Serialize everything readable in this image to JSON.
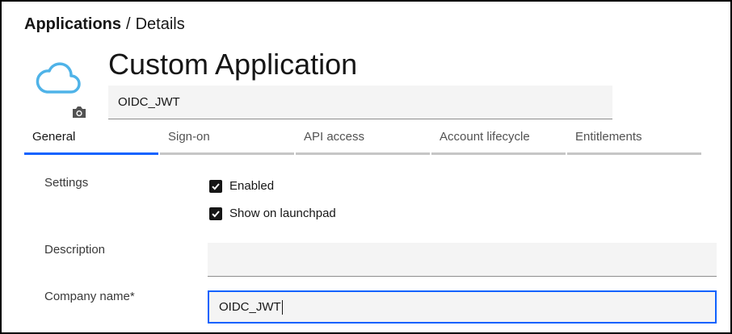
{
  "breadcrumb": {
    "parent": "Applications",
    "separator": "/",
    "current": "Details"
  },
  "app": {
    "title": "Custom Application",
    "name_value": "OIDC_JWT",
    "icon": "cloud-icon",
    "photo_icon": "camera-icon"
  },
  "tabs": [
    {
      "label": "General",
      "active": true
    },
    {
      "label": "Sign-on",
      "active": false
    },
    {
      "label": "API access",
      "active": false
    },
    {
      "label": "Account lifecycle",
      "active": false
    },
    {
      "label": "Entitlements",
      "active": false
    }
  ],
  "form": {
    "settings_label": "Settings",
    "enabled_label": "Enabled",
    "enabled_checked": true,
    "launchpad_label": "Show on launchpad",
    "launchpad_checked": true,
    "description_label": "Description",
    "description_value": "",
    "company_label": "Company name*",
    "company_value": "OIDC_JWT"
  },
  "colors": {
    "accent": "#0f62fe",
    "cloud": "#4fb3e8",
    "field_bg": "#f4f4f4",
    "tab_inactive_border": "#c6c6c6"
  }
}
